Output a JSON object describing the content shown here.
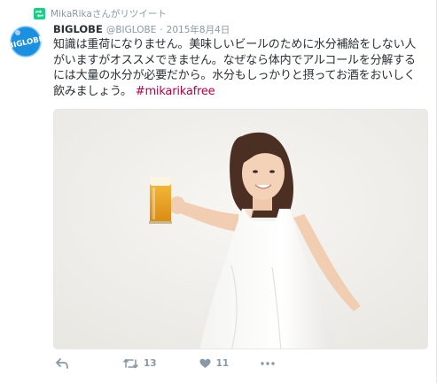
{
  "retweet_context": {
    "text": "MikaRikaさんがリツイート",
    "icon": "retweet-badge-icon"
  },
  "tweet": {
    "avatar_text": "BIGLOBE",
    "name": "BIGLOBE",
    "handle": "@BIGLOBE",
    "separator": "·",
    "date": "2015年8月4日",
    "body_lines": [
      "知識は重荷になりません。美味しいビールのために水分補給をしない人",
      "がいますがオススメできません。なぜなら体内でアルコールを分解する",
      "には大量の水分が必要だから。水分もしっかりと摂ってお酒をおいしく",
      "飲みましょう。"
    ],
    "hashtag": "#mikarikafree"
  },
  "photo": {
    "subject": "woman-holding-beer-glass"
  },
  "actions": {
    "reply_icon": "reply-icon",
    "retweet_icon": "retweet-icon",
    "retweet_count": "13",
    "like_icon": "heart-icon",
    "like_count": "11",
    "more_icon": "more-icon"
  },
  "colors": {
    "retweet_green": "#19cf86",
    "avatar_blue": "#1b8fe0",
    "hashtag": "#bb0046",
    "muted": "#8899a6"
  }
}
